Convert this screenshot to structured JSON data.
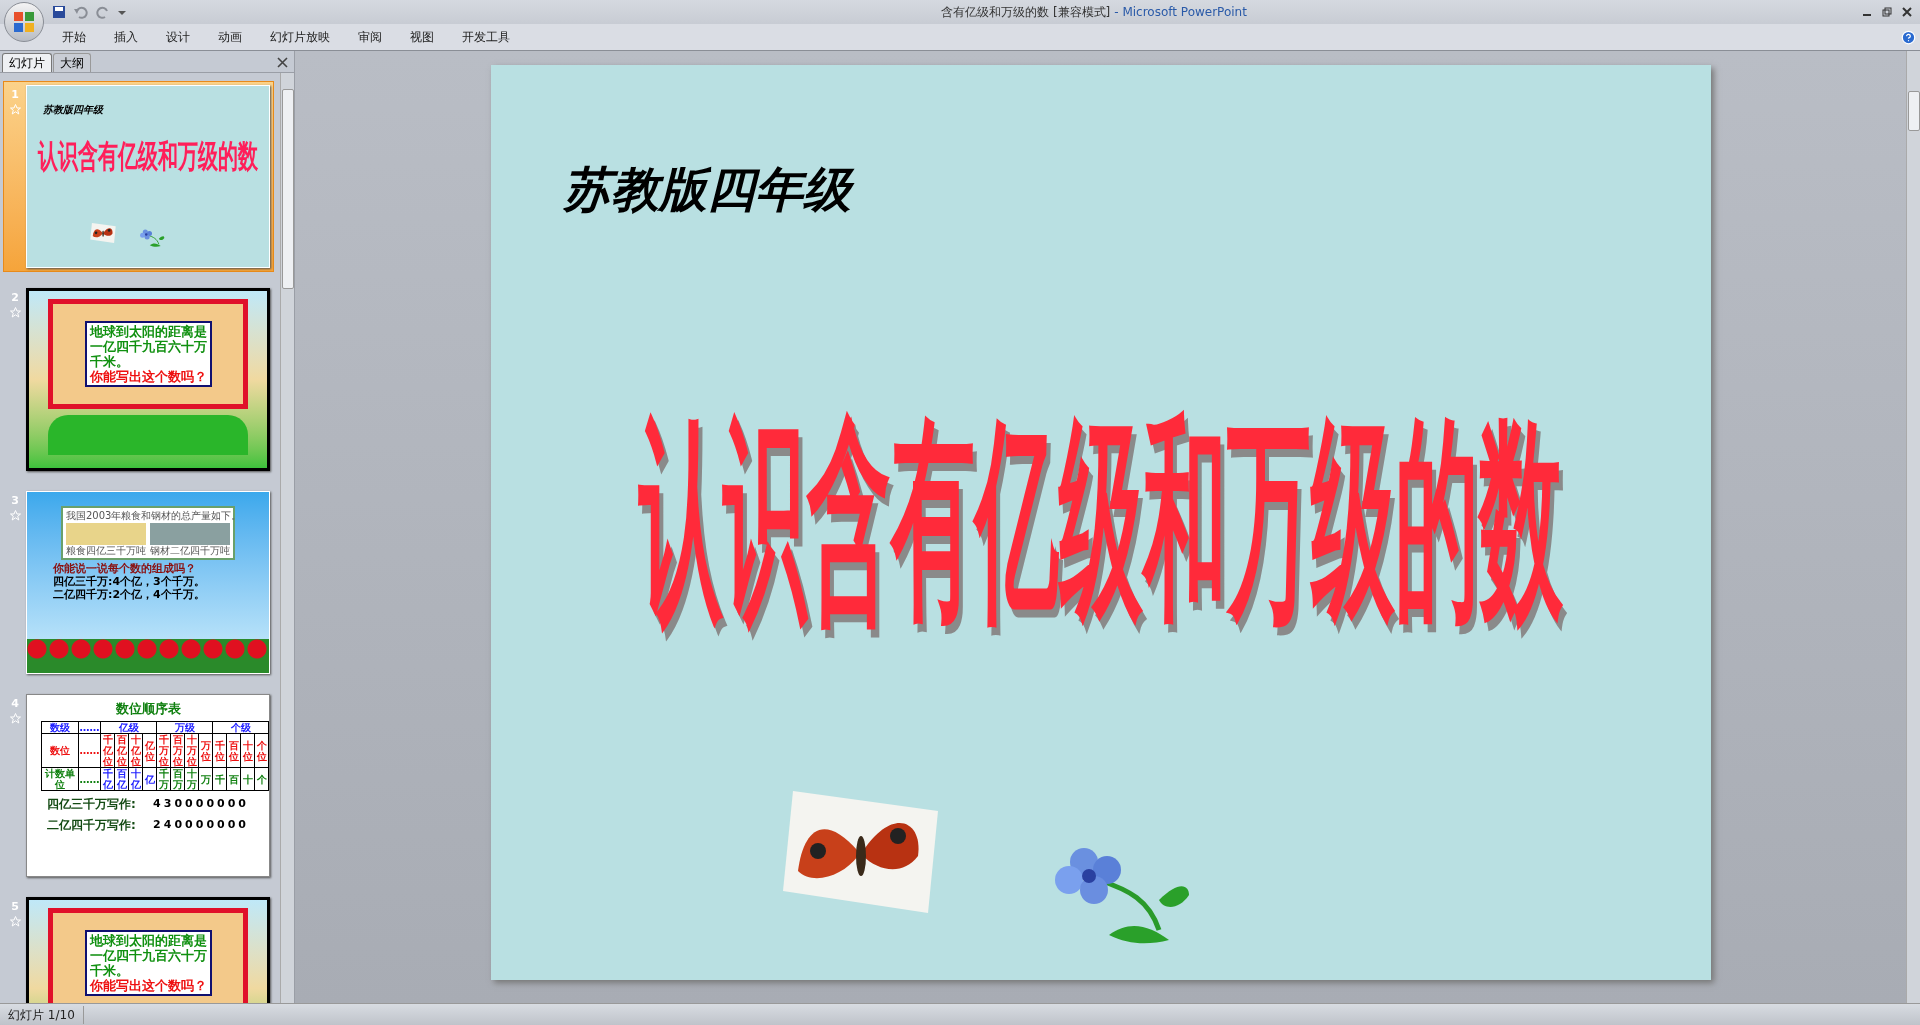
{
  "window": {
    "title": "含有亿级和万级的数 [兼容模式]",
    "app_name": "- Microsoft PowerPoint"
  },
  "ribbon_tabs": [
    "开始",
    "插入",
    "设计",
    "动画",
    "幻灯片放映",
    "审阅",
    "视图",
    "开发工具"
  ],
  "pane_tabs": [
    {
      "label": "幻灯片",
      "selected": true
    },
    {
      "label": "大纲",
      "selected": false
    }
  ],
  "slides": [
    {
      "number": "1",
      "selected": true,
      "kind": "title",
      "subtitle": "苏教版四年级",
      "title": "认识含有亿级和万级的数"
    },
    {
      "number": "2",
      "selected": false,
      "kind": "question",
      "lines": [
        "地球到太阳的距离是",
        "一亿四千九百六十万",
        "千米。"
      ],
      "question": "你能写出这个数吗？"
    },
    {
      "number": "3",
      "selected": false,
      "kind": "photos",
      "intro": "我国2003年粮食和钢材的总产量如下。",
      "captions": [
        "粮食四亿三千万吨",
        "钢材二亿四千万吨"
      ],
      "question": "你能说一说每个数的组成吗？",
      "lines": [
        "四亿三千万:4个亿，3个千万。",
        "二亿四千万:2个亿，4个千万。"
      ]
    },
    {
      "number": "4",
      "selected": false,
      "kind": "table",
      "title": "数位顺序表",
      "groups": [
        "数级",
        "……",
        "亿级",
        "万级",
        "个级"
      ],
      "rows": [
        [
          "数位",
          "……",
          "千亿位",
          "百亿位",
          "十亿位",
          "亿位",
          "千万位",
          "百万位",
          "十万位",
          "万位",
          "千位",
          "百位",
          "十位",
          "个位"
        ],
        [
          "计数单位",
          "……",
          "千亿",
          "百亿",
          "十亿",
          "亿",
          "千万",
          "百万",
          "十万",
          "万",
          "千",
          "百",
          "十",
          "个"
        ]
      ],
      "writings": [
        {
          "label": "四亿三千万写作:",
          "number": "430000000"
        },
        {
          "label": "二亿四千万写作:",
          "number": "240000000"
        }
      ]
    },
    {
      "number": "5",
      "selected": false,
      "kind": "question",
      "lines": [
        "地球到太阳的距离是",
        "一亿四千九百六十万",
        "千米。"
      ],
      "question": "你能写出这个数吗？"
    }
  ],
  "current_slide": {
    "subtitle": "苏教版四年级",
    "title": "认识含有亿级和万级的数"
  },
  "status_bar": {
    "slide_indicator": "幻灯片 1/10"
  }
}
